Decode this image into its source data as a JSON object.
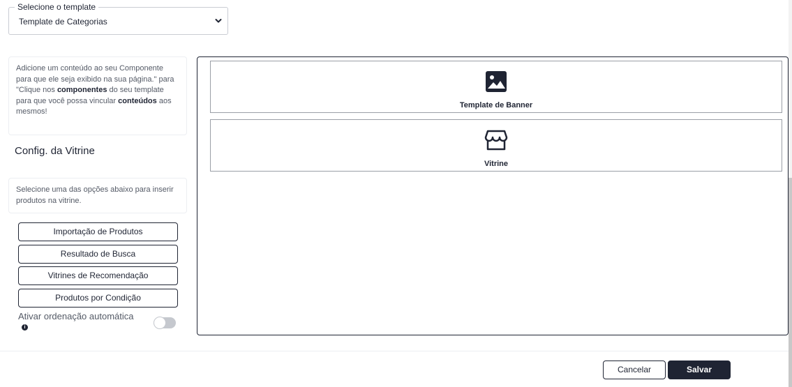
{
  "template_select": {
    "legend": "Selecione o template",
    "value": "Template de Categorias"
  },
  "sidebar": {
    "info": {
      "part1": "Adicione um conteúdo ao seu Componente para que ele seja exibido na sua página.\" para \"Clique nos ",
      "bold1": "componentes",
      "part2": " do seu template para que você possa vincular ",
      "bold2": "conteúdos",
      "part3": " aos mesmos!"
    },
    "section_title": "Config. da Vitrine",
    "options_hint": "Selecione uma das opções abaixo para inserir produtos na vitrine.",
    "options": [
      {
        "label": "Importação de Produtos"
      },
      {
        "label": "Resultado de Busca"
      },
      {
        "label": "Vitrines de Recomendação"
      },
      {
        "label": "Produtos por Condição"
      }
    ],
    "auto_sort": {
      "label": "Ativar ordenação automática",
      "info_glyph": "i",
      "enabled": false
    }
  },
  "canvas": {
    "blocks": [
      {
        "label": "Template de Banner",
        "icon": "image-icon"
      },
      {
        "label": "Vitrine",
        "icon": "storefront-icon"
      }
    ]
  },
  "footer": {
    "cancel_label": "Cancelar",
    "save_label": "Salvar"
  },
  "colors": {
    "primary": "#1f2433",
    "border_light": "#eceef2",
    "text_muted": "#545a66",
    "toggle_off": "#c5c8ce"
  }
}
